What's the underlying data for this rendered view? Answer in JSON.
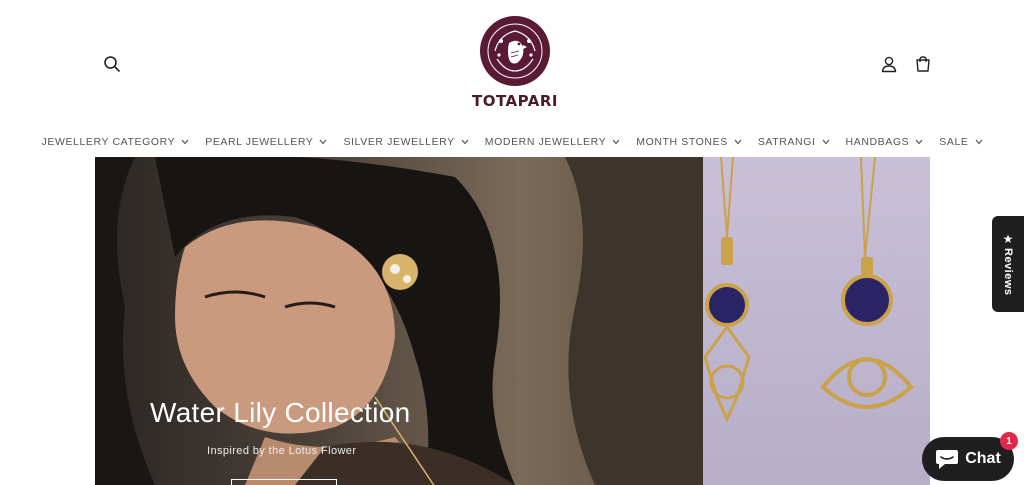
{
  "brand": {
    "name": "TOTAPARI",
    "logo_color": "#5a1a33"
  },
  "header": {
    "search_icon": "search-icon",
    "account_icon": "user-icon",
    "cart_icon": "cart-icon"
  },
  "nav": {
    "items": [
      {
        "label": "JEWELLERY CATEGORY"
      },
      {
        "label": "PEARL JEWELLERY"
      },
      {
        "label": "SILVER JEWELLERY"
      },
      {
        "label": "MODERN JEWELLERY"
      },
      {
        "label": "MONTH STONES"
      },
      {
        "label": "SATRANGI"
      },
      {
        "label": "HANDBAGS"
      },
      {
        "label": "SALE"
      }
    ]
  },
  "hero": {
    "title": "Water Lily Collection",
    "subtitle": "Inspired by the Lotus Flower"
  },
  "widgets": {
    "reviews_label": "Reviews",
    "chat_label": "Chat",
    "chat_badge": "1"
  }
}
